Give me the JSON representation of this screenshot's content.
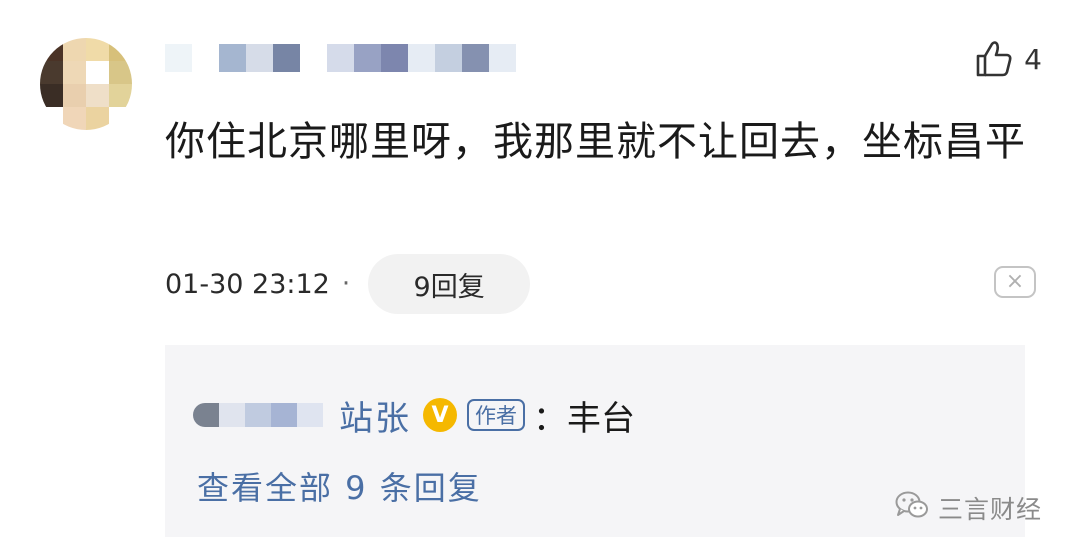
{
  "comment": {
    "text": "你住北京哪里呀，我那里就不让回去，坐标昌平",
    "like_count": "4",
    "timestamp": "01-30 23:12",
    "separator": "·",
    "reply_count_label": "9回复",
    "close_label": "×",
    "username_mosaic_colors": [
      "#eef4f8",
      "#ffffff",
      "#a5b6d0",
      "#d6dce8",
      "#7785a5",
      "#ffffff",
      "#d5dbea",
      "#98a2c4",
      "#7d86ae",
      "#e6ecf4",
      "#c4cfe0",
      "#8591b0",
      "#e6ecf4"
    ],
    "avatar_mosaic_colors": [
      "#4b3326",
      "#eed7b0",
      "#f0dba8",
      "#d7c07a",
      "#4a3a2e",
      "#eed8b6",
      "#ffffff",
      "#d8c688",
      "#3a2d25",
      "#e9cfae",
      "#efdfc8",
      "#e2d39a",
      "#ffffff",
      "#f0d6b8",
      "#ebd3a0",
      "#ffffff"
    ]
  },
  "reply": {
    "author": "站张",
    "verified_glyph": "V",
    "author_tag": "作者",
    "text": "：丰台",
    "view_all_label": "查看全部 9 条回复",
    "name_mosaic_colors": [
      "#7a8290",
      "#e0e4ee",
      "#c0cbe0",
      "#a6b4d4",
      "#dfe4f0"
    ]
  },
  "watermark": {
    "text": "三言财经"
  },
  "colors": {
    "link_blue": "#4a6fa5",
    "verified_gold": "#f5b800",
    "reply_panel_bg": "#f5f5f7",
    "pill_bg": "#f2f2f2"
  },
  "icons": {
    "like": "thumbs-up-icon",
    "close": "close-icon",
    "verified": "verified-badge-icon",
    "watermark": "wechat-icon"
  }
}
